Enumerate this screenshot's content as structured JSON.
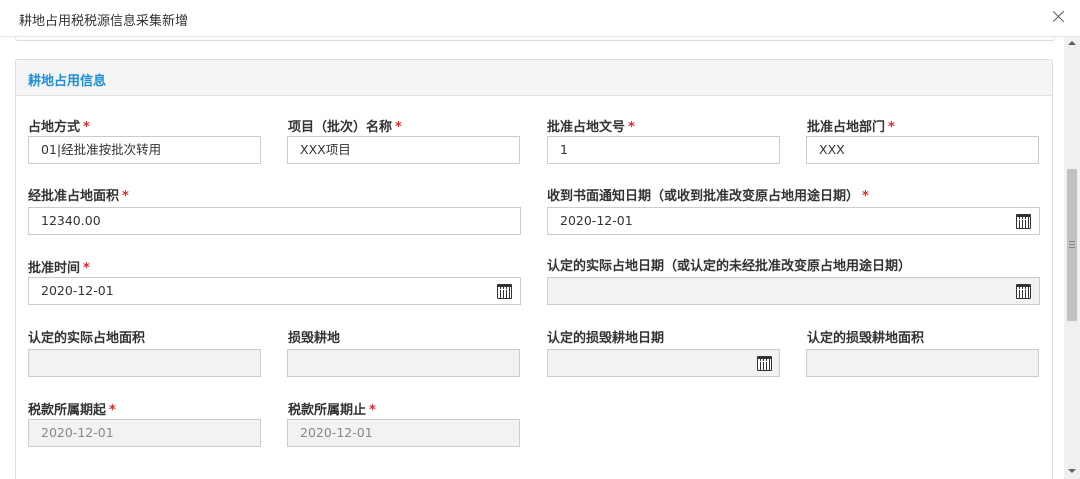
{
  "dialog": {
    "title": "耕地占用税税源信息采集新增"
  },
  "section": {
    "title": "耕地占用信息"
  },
  "required_mark": "*",
  "fields": {
    "occupation_method": {
      "label": "占地方式",
      "value": "01|经批准按批次转用"
    },
    "project_name": {
      "label": "项目（批次）名称",
      "value": "XXX项目"
    },
    "approval_doc_no": {
      "label": "批准占地文号",
      "value": "1"
    },
    "approval_dept": {
      "label": "批准占地部门",
      "value": "XXX"
    },
    "approved_area": {
      "label": "经批准占地面积",
      "value": "12340.00"
    },
    "notice_date": {
      "label": "收到书面通知日期（或收到批准改变原占地用途日期）",
      "value": "2020-12-01"
    },
    "approval_time": {
      "label": "批准时间",
      "value": "2020-12-01"
    },
    "actual_occupation_date": {
      "label": "认定的实际占地日期（或认定的未经批准改变原占地用途日期）",
      "value": ""
    },
    "actual_area": {
      "label": "认定的实际占地面积",
      "value": ""
    },
    "damaged_land": {
      "label": "损毁耕地",
      "value": ""
    },
    "damage_date": {
      "label": "认定的损毁耕地日期",
      "value": ""
    },
    "damaged_area": {
      "label": "认定的损毁耕地面积",
      "value": ""
    },
    "tax_period_start": {
      "label": "税款所属期起",
      "value": "2020-12-01"
    },
    "tax_period_end": {
      "label": "税款所属期止",
      "value": "2020-12-01"
    }
  },
  "colors": {
    "section_title": "#1e8ed8",
    "required": "#e02b2b",
    "header_bg": "#f5f5f5",
    "disabled_bg": "#f2f2f2"
  },
  "icons": [
    "close-icon",
    "calendar-icon"
  ]
}
